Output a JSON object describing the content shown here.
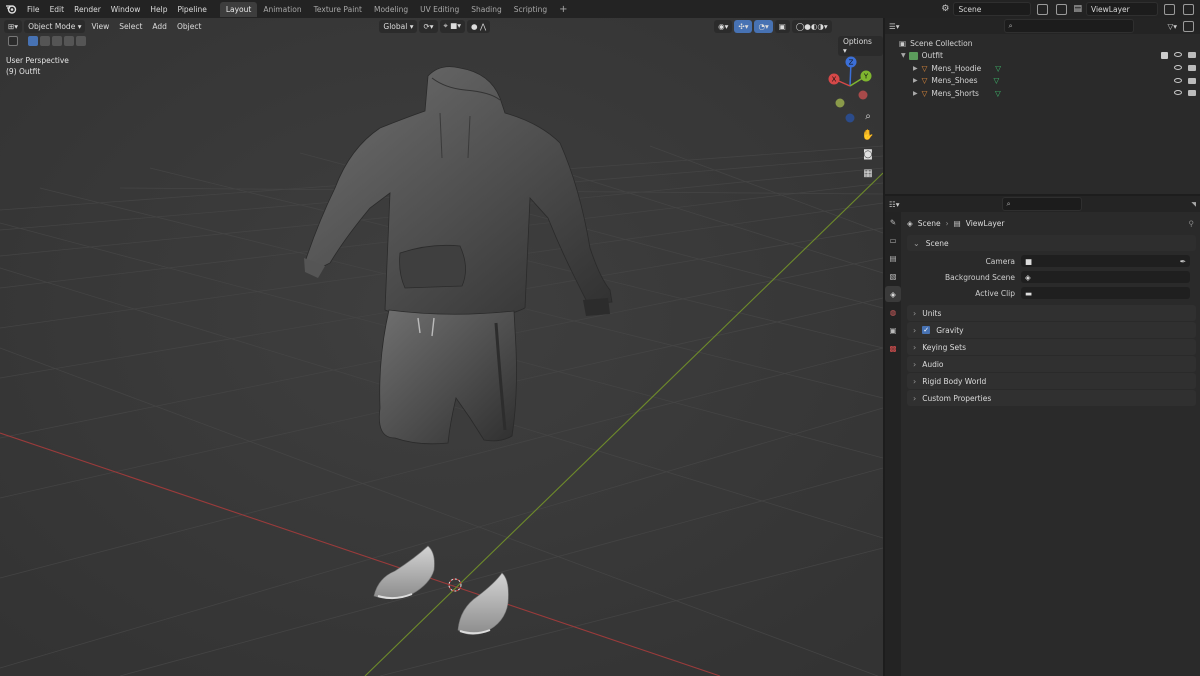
{
  "topbar": {
    "menus": [
      "File",
      "Edit",
      "Render",
      "Window",
      "Help",
      "Pipeline"
    ],
    "workspaces": [
      "Layout",
      "Animation",
      "Texture Paint",
      "Modeling",
      "UV Editing",
      "Shading",
      "Scripting"
    ],
    "active_workspace": "Layout",
    "add_workspace": "+",
    "scene_label": "Scene",
    "view_layer_label": "ViewLayer"
  },
  "viewport": {
    "mode_label": "Object Mode",
    "menus": [
      "View",
      "Select",
      "Add",
      "Object"
    ],
    "orientation_label": "Global",
    "options_label": "Options",
    "perspective_text": "User Perspective",
    "collection_text": "(9) Outfit",
    "gizmo": {
      "z": "Z",
      "y": "Y",
      "x": "X"
    }
  },
  "outliner": {
    "root": "Scene Collection",
    "collection": "Outfit",
    "items": [
      "Mens_Hoodie",
      "Mens_Shoes",
      "Mens_Shorts"
    ]
  },
  "properties": {
    "breadcrumb": [
      "Scene",
      "ViewLayer"
    ],
    "scene_panel": "Scene",
    "fields": [
      {
        "label": "Camera",
        "value": ""
      },
      {
        "label": "Background Scene",
        "value": ""
      },
      {
        "label": "Active Clip",
        "value": ""
      }
    ],
    "panels": [
      "Units",
      "Gravity",
      "Keying Sets",
      "Audio",
      "Rigid Body World",
      "Custom Properties"
    ],
    "gravity_checked": true
  },
  "colors": {
    "viewport_bg": "#3a3a3a",
    "axis_x": "#9b3b3b",
    "axis_y": "#6e8b2a",
    "accent": "#4772b3"
  }
}
